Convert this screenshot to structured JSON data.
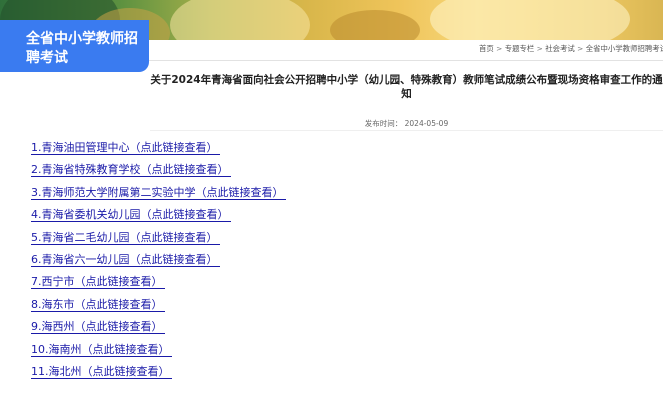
{
  "sidebar": {
    "title": "全省中小学教师招聘考试"
  },
  "breadcrumb": [
    "首页",
    "专题专栏",
    "社会考试",
    "全省中小学教师招聘考试"
  ],
  "breadcrumb_separator": ">",
  "article": {
    "title": "关于2024年青海省面向社会公开招聘中小学（幼儿园、特殊教育）教师笔试成绩公布暨现场资格审查工作的通知",
    "pubdate_label": "发布时间：",
    "pubdate": "2024-05-09",
    "links": [
      "1.青海油田管理中心（点此链接查看）",
      "2.青海省特殊教育学校（点此链接查看）",
      "3.青海师范大学附属第二实验中学（点此链接查看）",
      "4.青海省委机关幼儿园（点此链接查看）",
      "5.青海省二毛幼儿园（点此链接查看）",
      "6.青海省六一幼儿园（点此链接查看）",
      "7.西宁市（点此链接查看）",
      "8.海东市（点此链接查看）",
      "9.海西州（点此链接查看）",
      "10.海南州（点此链接查看）",
      "11.海北州（点此链接查看）"
    ]
  },
  "colors": {
    "accent": "#3a7bf0",
    "link": "#1a1aa8"
  }
}
